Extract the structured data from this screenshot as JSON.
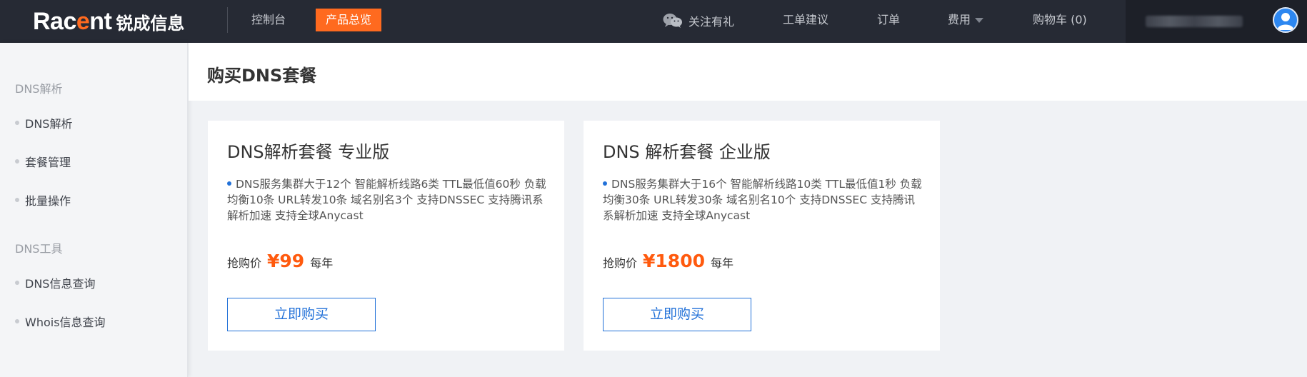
{
  "brand": {
    "logo_en_pre": "Rac",
    "logo_en_accent": "e",
    "logo_en_post": "nt",
    "logo_cn": "锐成信息"
  },
  "topnav": {
    "console": "控制台",
    "products": "产品总览",
    "wechat": "关注有礼",
    "ticket": "工单建议",
    "orders": "订单",
    "fees": "费用",
    "cart": "购物车 (0)"
  },
  "sidebar": {
    "group1": "DNS解析",
    "items1": [
      "DNS解析",
      "套餐管理",
      "批量操作"
    ],
    "group2": "DNS工具",
    "items2": [
      "DNS信息查询",
      "Whois信息查询"
    ]
  },
  "page": {
    "title": "购买DNS套餐"
  },
  "cards": [
    {
      "title": "DNS解析套餐 专业版",
      "desc": "DNS服务集群大于12个 智能解析线路6类 TTL最低值60秒 负载均衡10条 URL转发10条 域名别名3个 支持DNSSEC 支持腾讯系解析加速 支持全球Anycast",
      "price_label": "抢购价",
      "price": "¥99",
      "price_unit": "每年",
      "buy": "立即购买"
    },
    {
      "title": "DNS 解析套餐 企业版",
      "desc": "DNS服务集群大于16个 智能解析线路10类 TTL最低值1秒 负载均衡30条 URL转发30条 域名别名10个 支持DNSSEC 支持腾讯系解析加速 支持全球Anycast",
      "price_label": "抢购价",
      "price": "¥1800",
      "price_unit": "每年",
      "buy": "立即购买"
    }
  ],
  "colors": {
    "topbar": "#262a34",
    "accent": "#ff6a1f",
    "primary": "#2271d8",
    "price": "#ff5a0e"
  },
  "icons": [
    "wechat-icon",
    "caret-down-icon",
    "user-avatar-icon",
    "bullet-dot-icon"
  ]
}
